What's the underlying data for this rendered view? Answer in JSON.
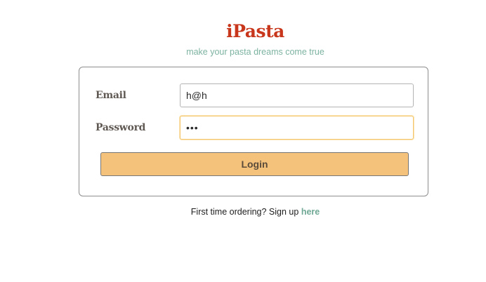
{
  "header": {
    "brand": "iPasta",
    "tagline": "make your pasta dreams come true"
  },
  "form": {
    "email_label": "Email",
    "email_value": "h@h",
    "password_label": "Password",
    "password_value": "abc",
    "login_label": "Login"
  },
  "footer": {
    "prompt": "First time ordering? Sign up",
    "link_label": "here"
  },
  "colors": {
    "brand": "#c8371c",
    "tagline": "#7eb3a1",
    "button": "#f5c27b",
    "focus_border": "#f4c76d",
    "link": "#6fa895"
  }
}
